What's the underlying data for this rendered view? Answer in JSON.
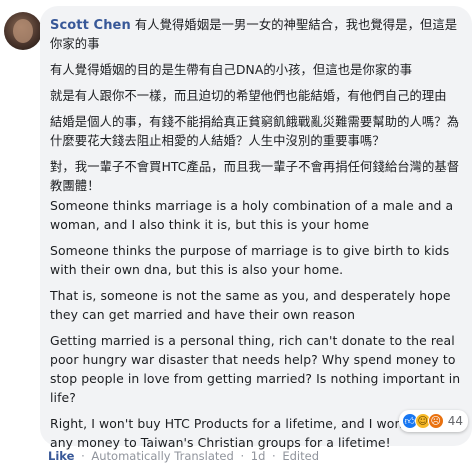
{
  "comment": {
    "author": "Scott Chen",
    "paragraphs": [
      "有人覺得婚姻是一男一女的神聖結合，我也覺得是，但這是你家的事",
      "有人覺得婚姻的目的是生帶有自己DNA的小孩，但這也是你家的事",
      "就是有人跟你不一樣，而且迫切的希望他們也能結婚，有他們自己的理由",
      "結婚是個人的事，有錢不能捐給真正貧窮飢餓戰亂災難需要幫助的人嗎？為什麼要花大錢去阻止相愛的人結婚？人生中沒別的重要事嗎？",
      "對，我一輩子不會買HTC產品，而且我一輩子不會再捐任何錢給台灣的基督教團體！",
      "Someone thinks marriage is a holy combination of a male and a woman, and I also think it is, but this is your home",
      "Someone thinks the purpose of marriage is to give birth to kids with their own dna, but this is also your home.",
      "That is, someone is not the same as you, and desperately hope they can get married and have their own reason",
      "Getting married is a personal thing, rich can't donate to the real poor hungry war disaster that needs help? Why spend money to stop people in love from getting married? Is nothing important in life?",
      "Right, I won't buy HTC Products for a lifetime, and I won't donate any money to Taiwan's Christian groups for a lifetime!"
    ],
    "reactions": {
      "icons": [
        "like-icon",
        "haha-icon",
        "angry-icon"
      ],
      "count": "44"
    }
  },
  "footer": {
    "like": "Like",
    "sep1": "·",
    "translated": "Automatically Translated",
    "sep2": "·",
    "time": "1d",
    "sep3": "·",
    "edited": "Edited"
  },
  "colors": {
    "author": "#385898",
    "bubble": "#f2f3f5",
    "meta": "#90949c",
    "like_reaction": "#1877f2",
    "haha_reaction": "#f7b928",
    "angry_reaction": "#e9710f"
  }
}
